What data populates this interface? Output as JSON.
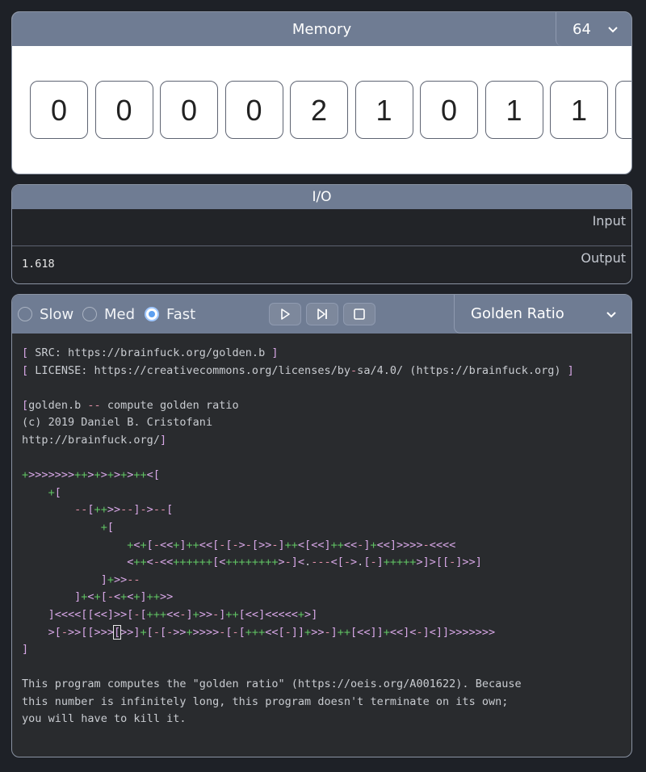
{
  "memory": {
    "title": "Memory",
    "size_value": "64",
    "cells": [
      "0",
      "0",
      "0",
      "0",
      "2",
      "1",
      "0",
      "1",
      "1",
      ""
    ]
  },
  "io": {
    "title": "I/O",
    "input_label": "Input",
    "input_value": "",
    "output_label": "Output",
    "output_value": "1.618"
  },
  "controls": {
    "speeds": [
      {
        "label": "Slow",
        "selected": false
      },
      {
        "label": "Med",
        "selected": false
      },
      {
        "label": "Fast",
        "selected": true
      }
    ],
    "buttons": [
      "run",
      "step",
      "stop"
    ],
    "program_selected": "Golden Ratio"
  },
  "code": {
    "lines": [
      "[ SRC: https://brainfuck.org/golden.b ]",
      "[ LICENSE: https://creativecommons.org/licenses/by-sa/4.0/ (https://brainfuck.org) ]",
      "",
      "[golden.b -- compute golden ratio",
      "(c) 2019 Daniel B. Cristofani",
      "http://brainfuck.org/]",
      "",
      "+>>>>>>>++>+>+>+>++<[",
      "    +[",
      "        --[++>>--]->--[",
      "            +[",
      "                +<+[-<<+]++<<[-[->-[>>-]++<[<<]++<<-]+<<]>>>>-<<<<",
      "                <++<-<<++++++[<++++++++>-]<.---<[->.[-]+++++>]>[[-]>>]",
      "            ]+>>--",
      "        ]+<+[-<+<+]++>>",
      "    ]<<<<[[<<]>>[-[+++<<-]+>>-]++[<<]<<<<<+>]",
      "    >[->>[[>>>[>>]+[-[->>+>>>>-[-[+++<<[-]]+>>-]++[<<]]+<<]<-]<]]>>>>>>>",
      "]",
      "",
      "This program computes the \"golden ratio\" (https://oeis.org/A001622). Because",
      "this number is infinitely long, this program doesn't terminate on its own;",
      "you will have to kill it."
    ],
    "cursor_line": 16,
    "cursor_col": 14
  },
  "colors": {
    "header": "#6f7c93",
    "editor_bg": "#292b2e",
    "bracket": "#d7a7e6",
    "plus": "#5fbf62",
    "minus": "#e08fa6"
  }
}
